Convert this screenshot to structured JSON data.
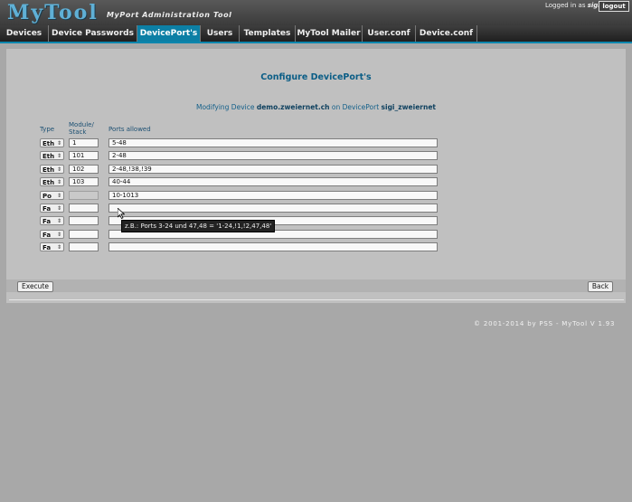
{
  "app": {
    "logo": "MyTool",
    "tagline": "MyPort Administration Tool"
  },
  "session": {
    "logged_prefix": "Logged in as",
    "user": "sigi",
    "logout_label": "logout"
  },
  "nav": {
    "tabs": [
      {
        "label": "Devices",
        "active": false
      },
      {
        "label": "Device Passwords",
        "active": false
      },
      {
        "label": "DevicePort's",
        "active": true
      },
      {
        "label": "Users",
        "active": false
      },
      {
        "label": "Templates",
        "active": false
      },
      {
        "label": "MyTool Mailer",
        "active": false
      },
      {
        "label": "User.conf",
        "active": false
      },
      {
        "label": "Device.conf",
        "active": false
      }
    ]
  },
  "page": {
    "title": "Configure DevicePort's",
    "modifying_prefix": "Modifying Device",
    "device": "demo.zweiernet.ch",
    "on_deviceport": "on DevicePort",
    "deviceport": "sigi_zweiernet"
  },
  "table": {
    "headers": {
      "type": "Type",
      "module": "Module/",
      "stack": "Stack",
      "ports": "Ports allowed"
    },
    "rows": [
      {
        "type": "Eth",
        "module": "1",
        "ports": "5-48",
        "module_disabled": false
      },
      {
        "type": "Eth",
        "module": "101",
        "ports": "2-48",
        "module_disabled": false
      },
      {
        "type": "Eth",
        "module": "102",
        "ports": "2-48,!38,!39",
        "module_disabled": false
      },
      {
        "type": "Eth",
        "module": "103",
        "ports": "40-44",
        "module_disabled": false
      },
      {
        "type": "Po",
        "module": "",
        "ports": "10-1013",
        "module_disabled": true
      },
      {
        "type": "Fa",
        "module": "",
        "ports": "",
        "module_disabled": false
      },
      {
        "type": "Fa",
        "module": "",
        "ports": "",
        "module_disabled": false
      },
      {
        "type": "Fa",
        "module": "",
        "ports": "",
        "module_disabled": false
      },
      {
        "type": "Fa",
        "module": "",
        "ports": "",
        "module_disabled": false
      }
    ],
    "tooltip": "z.B.: Ports 3-24 und 47,48 = '1-24,!1,!2,47,48'"
  },
  "actions": {
    "execute_label": "Execute",
    "back_label": "Back"
  },
  "footer": {
    "copyright": "© 2001-2014 by PSS - MyTool V 1.93"
  },
  "colors": {
    "accent": "#0c7fa5",
    "logo": "#5fb0d6",
    "title": "#0a5d86"
  }
}
